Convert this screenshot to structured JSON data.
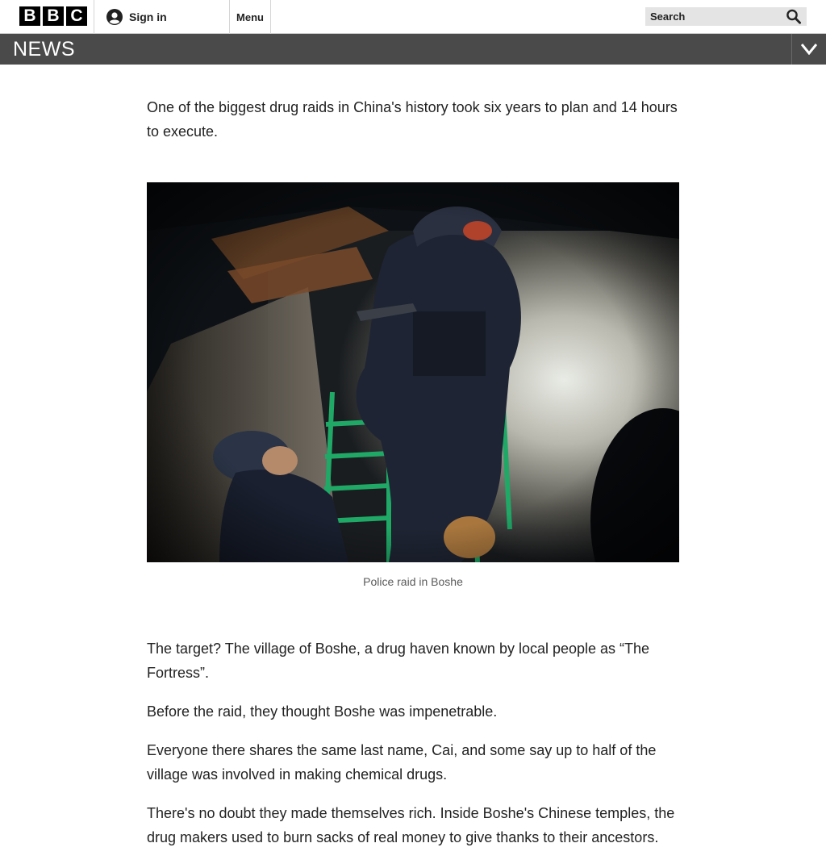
{
  "header": {
    "logo_letters": [
      "B",
      "B",
      "C"
    ],
    "signin_label": "Sign in",
    "menu_label": "Menu",
    "search_placeholder": "Search"
  },
  "newsbar": {
    "title": "NEWS"
  },
  "article": {
    "lead": "One of the biggest drug raids in China's history took six years to plan and 14 hours to execute.",
    "image_caption": "Police raid in Boshe",
    "paragraphs": [
      "The target? The village of Boshe, a drug haven known by local people as “The Fortress”.",
      "Before the raid, they thought Boshe was impenetrable.",
      "Everyone there shares the same last name, Cai, and some say up to half of the village was involved in making chemical drugs.",
      "There's no doubt they made themselves rich. Inside Boshe's Chinese temples, the drug makers used to burn sacks of real money to give thanks to their ancestors."
    ]
  },
  "icons": {
    "user": "user-icon",
    "search": "search-icon",
    "chevron": "chevron-down-icon"
  },
  "colors": {
    "newsbar": "#4a4a4a",
    "search_bg": "#e4e4e4",
    "text": "#222222",
    "caption": "#5a5a5a"
  }
}
